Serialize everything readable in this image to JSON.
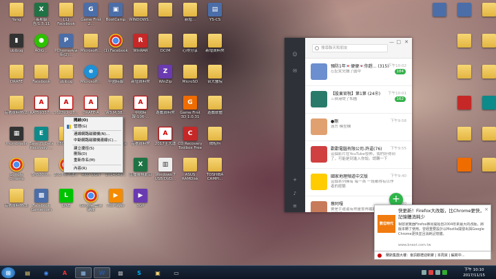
{
  "desktop": {
    "icons": [
      {
        "label": "Yang",
        "kind": "folder",
        "glyph": ""
      },
      {
        "label": "長期報告/1.5.11",
        "kind": "excel",
        "glyph": "X"
      },
      {
        "label": "【1】Facebook",
        "kind": "folder",
        "glyph": ""
      },
      {
        "label": "Game First 2...",
        "kind": "exe",
        "glyph": "G"
      },
      {
        "label": "BootCamp",
        "kind": "exe",
        "glyph": "▣"
      },
      {
        "label": "WINDOWS...",
        "kind": "folder",
        "glyph": ""
      },
      {
        "label": "",
        "kind": "folder",
        "glyph": ""
      },
      {
        "label": "新增...",
        "kind": "folder",
        "glyph": ""
      },
      {
        "label": "YS-CS",
        "kind": "exe",
        "glyph": "▤"
      },
      {
        "label": "ubibug",
        "kind": "dark",
        "glyph": "▮"
      },
      {
        "label": "AOIG...",
        "kind": "wechat",
        "glyph": "●"
      },
      {
        "label": "PChome商店街(2)...",
        "kind": "exe",
        "glyph": "P"
      },
      {
        "label": "Microsoft...",
        "kind": "folder",
        "glyph": ""
      },
      {
        "label": "(1) Facebook",
        "kind": "chrome",
        "glyph": ""
      },
      {
        "label": "WinRAR",
        "kind": "red",
        "glyph": "R"
      },
      {
        "label": "DCIM",
        "kind": "folder",
        "glyph": ""
      },
      {
        "label": "心得分享",
        "kind": "folder",
        "glyph": ""
      },
      {
        "label": "新增資料夾",
        "kind": "folder",
        "glyph": ""
      },
      {
        "label": "DRAFE",
        "kind": "folder",
        "glyph": ""
      },
      {
        "label": "Facebook",
        "kind": "folder",
        "glyph": ""
      },
      {
        "label": "ubibug",
        "kind": "folder",
        "glyph": ""
      },
      {
        "label": "Microsoft...",
        "kind": "ie",
        "glyph": "e"
      },
      {
        "label": "中國時報",
        "kind": "folder",
        "glyph": ""
      },
      {
        "label": "新增資料夾",
        "kind": "folder",
        "glyph": ""
      },
      {
        "label": "WinZip",
        "kind": "purple",
        "glyph": "Z"
      },
      {
        "label": "MicroSD",
        "kind": "folder",
        "glyph": ""
      },
      {
        "label": "台大醫院",
        "kind": "folder",
        "glyph": ""
      },
      {
        "label": "有著資料夾(2)",
        "kind": "folder",
        "glyph": ""
      },
      {
        "label": "KAT59337...",
        "kind": "pdf",
        "glyph": "A"
      },
      {
        "label": "362391_28...",
        "kind": "pdf",
        "glyph": "A"
      },
      {
        "label": "DRAFE-A",
        "kind": "pdf",
        "glyph": "A"
      },
      {
        "label": "W3,M,38...",
        "kind": "folder",
        "glyph": ""
      },
      {
        "label": "中國時報-106-...",
        "kind": "pdf",
        "glyph": "A"
      },
      {
        "label": "遊戲資料夾",
        "kind": "folder",
        "glyph": ""
      },
      {
        "label": "Game First 3D 1.0.31 (2)",
        "kind": "orange",
        "glyph": "G"
      },
      {
        "label": "遊戲軟體",
        "kind": "folder",
        "glyph": ""
      },
      {
        "label": "thumbnails",
        "kind": "dark",
        "glyph": "▦"
      },
      {
        "label": "EaseUS Data Recovery ...",
        "kind": "teal",
        "glyph": "E"
      },
      {
        "label": "050-1080",
        "kind": "folder",
        "glyph": ""
      },
      {
        "label": "Screenshot",
        "kind": "folder",
        "glyph": ""
      },
      {
        "label": "4Ket Firefox",
        "kind": "folder",
        "glyph": ""
      },
      {
        "label": "有著資料夾",
        "kind": "folder",
        "glyph": ""
      },
      {
        "label": "2017主大運",
        "kind": "pdf",
        "glyph": "A"
      },
      {
        "label": "CD Recovery Toolbox Free",
        "kind": "red",
        "glyph": "C"
      },
      {
        "label": "微點科",
        "kind": "folder",
        "glyph": ""
      },
      {
        "label": "Google Chrome",
        "kind": "chrome",
        "glyph": ""
      },
      {
        "label": "SHS30.0...",
        "kind": "folder",
        "glyph": ""
      },
      {
        "label": "2017主大運...",
        "kind": "chrome",
        "glyph": ""
      },
      {
        "label": "AKO SIGN",
        "kind": "folder",
        "glyph": ""
      },
      {
        "label": "2014049...",
        "kind": "folder",
        "glyph": ""
      },
      {
        "label": "直播電視節目",
        "kind": "excel",
        "glyph": "X"
      },
      {
        "label": "Windows 7 USB DVD...",
        "kind": "white",
        "glyph": "▥"
      },
      {
        "label": "ASUS RAMDisk",
        "kind": "folder",
        "glyph": ""
      },
      {
        "label": "TOSHIBA CAMPI...",
        "kind": "folder",
        "glyph": ""
      },
      {
        "label": "有著資料夾(3)",
        "kind": "folder",
        "glyph": ""
      },
      {
        "label": "Facebook Gameroom",
        "kind": "exe",
        "glyph": "▩"
      },
      {
        "label": "LINE",
        "kind": "line",
        "glyph": "L"
      },
      {
        "label": "Google 雲端硬碟",
        "kind": "chrome",
        "glyph": ""
      },
      {
        "label": "PotPlayer",
        "kind": "vlc",
        "glyph": "▶"
      },
      {
        "label": "3GP",
        "kind": "purple",
        "glyph": "▶"
      }
    ]
  },
  "context_menu": {
    "items": [
      "開啟(O)",
      "管理(G)",
      "連線網路磁碟機(N)...",
      "中斷網路磁碟機連線(C)...",
      "建立捷徑(S)",
      "刪除(D)",
      "重新命名(M)",
      "內容(R)"
    ]
  },
  "chat": {
    "search_placeholder": "搜尋聯天和朋友",
    "rows": [
      {
        "name": "預防1年💌便便💌你趕...  (315)",
        "preview": "忘記女兒讀了國中",
        "time": "下午10:02",
        "badge": "184",
        "color": "#6b8fcf"
      },
      {
        "name": "【股東官稅】第1第 (24Ⓑ)",
        "preview": "三宿港堤了知圖",
        "time": "下午10:01",
        "badge": "162",
        "color": "#2a7a6a"
      },
      {
        "name": "●剛",
        "preview": "遠方 模型機",
        "time": "下午9:58",
        "badge": "",
        "color": "#e0a070"
      },
      {
        "name": "歡歡電腦有限公司-許逼(76)",
        "preview": "這個影片在YouTube發佈，我們好得到了，可能是到進入你說。請轉一下",
        "time": "下午9:55",
        "badge": "",
        "color": "#d04040"
      },
      {
        "name": "國家地理頻道中文版",
        "preview": "這個系列擁有 每一首 一段都得有以作者的經驗",
        "time": "下午9:40",
        "badge": "",
        "color": "#ffcc00"
      },
      {
        "name": "蔡阿嘎",
        "preview": "要是手邊還有熱量會再繼續，我想是不是很好",
        "time": "下午9:30",
        "badge": "",
        "color": "#c77b5a"
      },
      {
        "name": "賴安等到電競基地店 (353)",
        "preview": "",
        "time": "下午9:20",
        "badge": "",
        "color": "#444"
      }
    ],
    "fab_label": "+"
  },
  "notification": {
    "logo_text": "數位時代",
    "title": "快更新！Firefox大改版，比Chrome更快，記憶體消耗少",
    "body": "相容瀏覽器Firefox推出開始自2004年來最大的改版，將版本轉了使用。曾經重要設計以Mozilla開發出與Google Chrome更快並且消耗記憶體。",
    "url": "www.bnext.com.tw",
    "close": "×",
    "strip": "蘭斯集團大樓：會訊觀禮迎新聚 | 本周資 | 編寫中..."
  },
  "taskbar": {
    "apps": [
      {
        "name": "file-explorer",
        "glyph": "▤",
        "color": "#f7d675"
      },
      {
        "name": "chrome",
        "glyph": "◉",
        "color": "#4a8ef0"
      },
      {
        "name": "pdf-reader",
        "glyph": "A",
        "color": "#e33"
      },
      {
        "name": "explorer-window",
        "glyph": "▦",
        "color": "#8cb8e8"
      },
      {
        "name": "word",
        "glyph": "W",
        "color": "#2b579a"
      },
      {
        "name": "grid-app",
        "glyph": "▩",
        "color": "#aaa"
      },
      {
        "name": "skype",
        "glyph": "S",
        "color": "#00aff0"
      },
      {
        "name": "folder",
        "glyph": "▣",
        "color": "#f7d675"
      },
      {
        "name": "window-app",
        "glyph": "▭",
        "color": "#ccc"
      }
    ],
    "time": "下午 10:10",
    "date": "2017/11/15"
  }
}
